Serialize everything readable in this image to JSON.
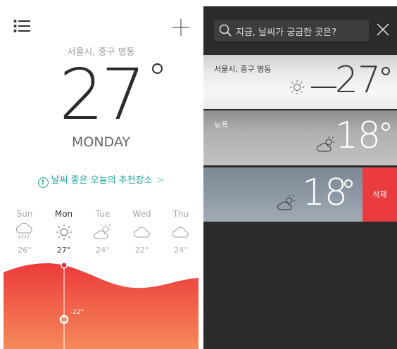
{
  "left": {
    "location": "서울시, 중구 명동",
    "temperature": "27",
    "day": "MONDAY",
    "recommend_icon": "!",
    "recommend_text": "날씨 좋은 오늘의 추천장소",
    "recommend_chevron": ">",
    "forecast": [
      {
        "day": "Sun",
        "icon": "rain-cloud-icon",
        "temp": "26°"
      },
      {
        "day": "Mon",
        "icon": "sun-icon",
        "temp": "27°"
      },
      {
        "day": "Tue",
        "icon": "partly-cloudy-icon",
        "temp": "24°"
      },
      {
        "day": "Wed",
        "icon": "cloud-icon",
        "temp": "22°"
      },
      {
        "day": "Thu",
        "icon": "cloud-icon",
        "temp": "24°"
      }
    ],
    "graph_label": "-22°",
    "graph_colors": {
      "top": "#ec3a3a",
      "bottom": "#f58a5a"
    }
  },
  "right": {
    "search_placeholder": "지금, 날씨가 궁금한 곳은?",
    "cities": [
      {
        "name": "서울시, 중구 명동",
        "temp": "27",
        "icon": "sun-icon"
      },
      {
        "name": "뉴욕",
        "temp": "18",
        "icon": "partly-cloudy-icon"
      },
      {
        "name": "",
        "temp": "18",
        "icon": "partly-cloudy-icon"
      }
    ],
    "delete_label": "삭제",
    "delete_color": "#ea3b3f"
  }
}
